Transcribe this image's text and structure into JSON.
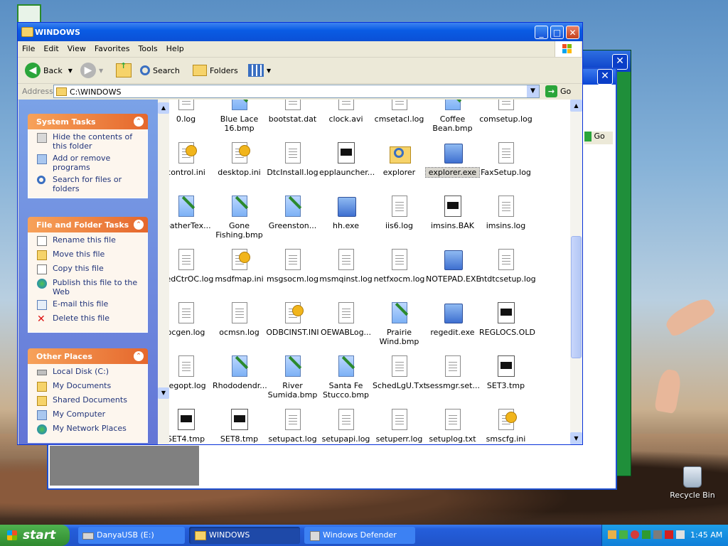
{
  "desktop": {
    "recycle_bin": "Recycle Bin"
  },
  "window": {
    "title": "WINDOWS",
    "min": "_",
    "max": "□",
    "close": "✕"
  },
  "menu": [
    "File",
    "Edit",
    "View",
    "Favorites",
    "Tools",
    "Help"
  ],
  "toolbar": {
    "back": "Back",
    "search": "Search",
    "folders": "Folders"
  },
  "address": {
    "label": "Address",
    "value": "C:\\WINDOWS",
    "go": "Go"
  },
  "system_tasks": {
    "title": "System Tasks",
    "items": [
      "Hide the contents of this folder",
      "Add or remove programs",
      "Search for files or folders"
    ]
  },
  "file_tasks": {
    "title": "File and Folder Tasks",
    "items": [
      "Rename this file",
      "Move this file",
      "Copy this file",
      "Publish this file to the Web",
      "E-mail this file",
      "Delete this file"
    ]
  },
  "other_places": {
    "title": "Other Places",
    "items": [
      "Local Disk (C:)",
      "My Documents",
      "Shared Documents",
      "My Computer",
      "My Network Places"
    ]
  },
  "files": [
    [
      "0.log",
      "Blue Lace 16.bmp",
      "bootstat.dat",
      "clock.avi",
      "cmsetacl.log",
      "Coffee Bean.bmp",
      "comsetup.log"
    ],
    [
      "control.ini",
      "desktop.ini",
      "DtcInstall.log",
      "epplauncher...",
      "explorer",
      "explorer.exe",
      "FaxSetup.log"
    ],
    [
      "FeatherTex...",
      "Gone Fishing.bmp",
      "Greenston...",
      "hh.exe",
      "iis6.log",
      "imsins.BAK",
      "imsins.log"
    ],
    [
      "MedCtrOC.log",
      "msdfmap.ini",
      "msgsocm.log",
      "msmqinst.log",
      "netfxocm.log",
      "NOTEPAD.EXE",
      "ntdtcsetup.log"
    ],
    [
      "ocgen.log",
      "ocmsn.log",
      "ODBCINST.INI",
      "OEWABLog...",
      "Prairie Wind.bmp",
      "regedit.exe",
      "REGLOCS.OLD"
    ],
    [
      "regopt.log",
      "Rhododendr...",
      "River Sumida.bmp",
      "Santa Fe Stucco.bmp",
      "SchedLgU.Txt",
      "sessmgr.set...",
      "SET3.tmp"
    ],
    [
      "SET4.tmp",
      "SET8.tmp",
      "setupact.log",
      "setupapi.log",
      "setuperr.log",
      "setuplog.txt",
      "smscfg.ini"
    ]
  ],
  "taskbar": {
    "start": "start",
    "tasks": [
      "DanyaUSB (E:)",
      "WINDOWS",
      "Windows Defender"
    ],
    "clock": "1:45 AM"
  },
  "colors": {
    "xp_blue": "#0a5ce4",
    "task_orange": "#e5672c",
    "start_green": "#3c9a3c",
    "taskbar_blue": "#245edb"
  }
}
